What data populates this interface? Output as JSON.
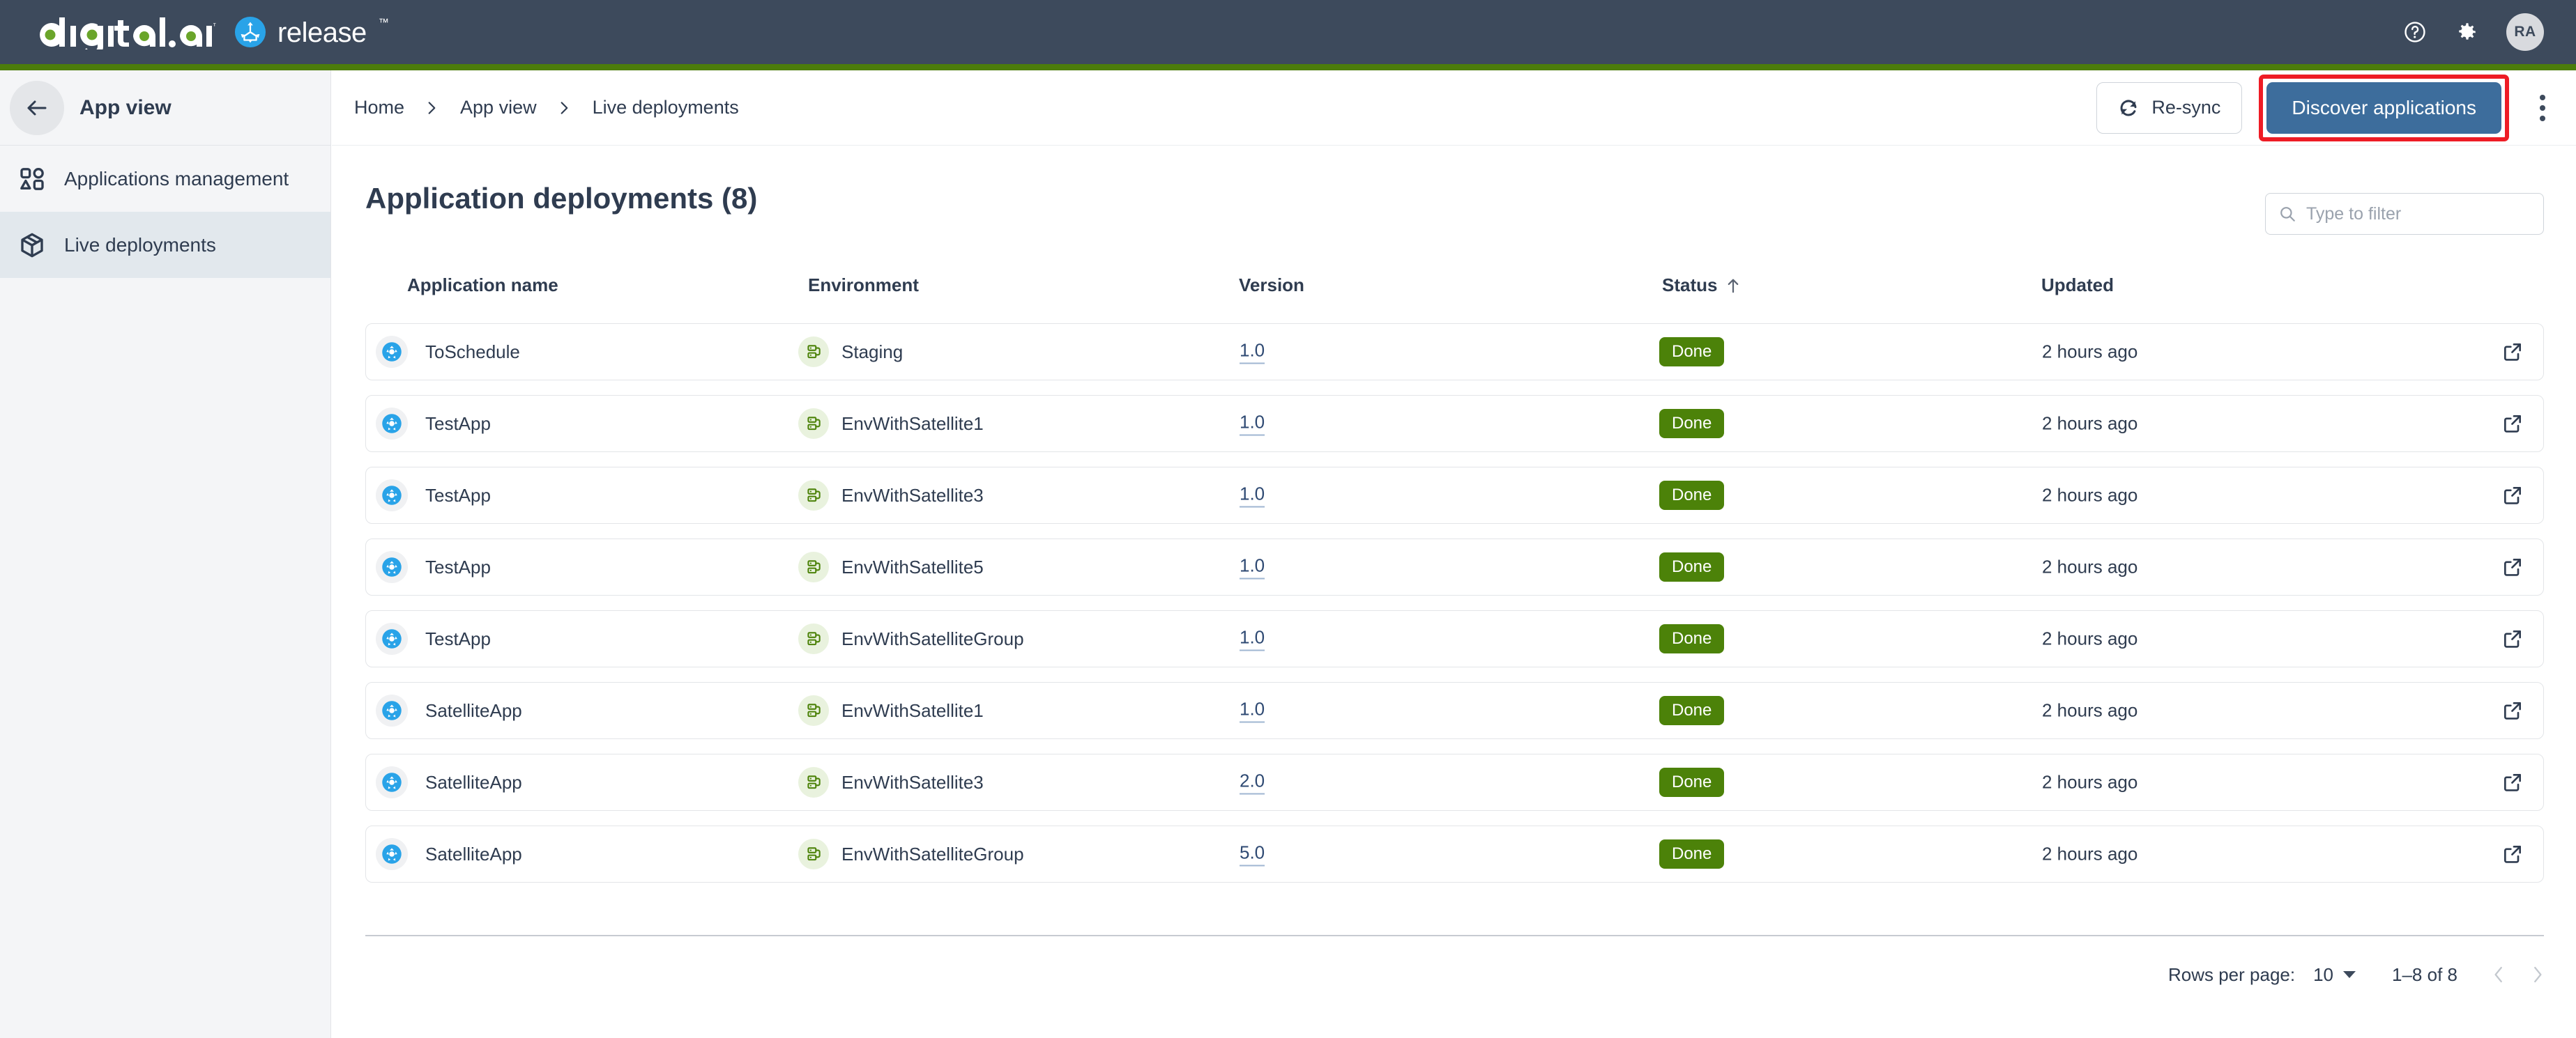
{
  "header": {
    "brand_primary": "digital.ai",
    "brand_secondary": "release",
    "trademark": "™",
    "help_icon": "help-circle-icon",
    "settings_icon": "gear-icon",
    "avatar_initials": "RA",
    "accent_green": "#4c7c0b",
    "bar_color": "#3d4a5c"
  },
  "sidebar": {
    "back_label": "App view",
    "back_icon": "arrow-left-icon",
    "items": [
      {
        "label": "Applications management",
        "icon": "shapes-icon",
        "active": false
      },
      {
        "label": "Live deployments",
        "icon": "package-icon",
        "active": true
      }
    ]
  },
  "breadcrumb": {
    "items": [
      "Home",
      "App view",
      "Live deployments"
    ],
    "separator_icon": "chevron-right-icon"
  },
  "toolbar": {
    "resync_label": "Re-sync",
    "resync_icon": "refresh-icon",
    "discover_label": "Discover applications",
    "discover_color": "#3d6d9c",
    "highlight_color": "#ee1c25",
    "overflow_icon": "more-vertical-icon"
  },
  "main": {
    "title": "Application deployments (8)",
    "deployment_count": 8,
    "filter": {
      "placeholder": "Type to filter",
      "value": "",
      "icon": "search-icon"
    },
    "columns": [
      {
        "key": "application_name",
        "label": "Application name",
        "sorted": false
      },
      {
        "key": "environment",
        "label": "Environment",
        "sorted": false
      },
      {
        "key": "version",
        "label": "Version",
        "sorted": false
      },
      {
        "key": "status",
        "label": "Status",
        "sorted": true,
        "sort_direction": "asc",
        "sort_icon": "arrow-up-icon"
      },
      {
        "key": "updated",
        "label": "Updated",
        "sorted": false
      }
    ],
    "rows": [
      {
        "application_name": "ToSchedule",
        "environment": "Staging",
        "version": "1.0",
        "status": "Done",
        "updated": "2 hours ago"
      },
      {
        "application_name": "TestApp",
        "environment": "EnvWithSatellite1",
        "version": "1.0",
        "status": "Done",
        "updated": "2 hours ago"
      },
      {
        "application_name": "TestApp",
        "environment": "EnvWithSatellite3",
        "version": "1.0",
        "status": "Done",
        "updated": "2 hours ago"
      },
      {
        "application_name": "TestApp",
        "environment": "EnvWithSatellite5",
        "version": "1.0",
        "status": "Done",
        "updated": "2 hours ago"
      },
      {
        "application_name": "TestApp",
        "environment": "EnvWithSatelliteGroup",
        "version": "1.0",
        "status": "Done",
        "updated": "2 hours ago"
      },
      {
        "application_name": "SatelliteApp",
        "environment": "EnvWithSatellite1",
        "version": "1.0",
        "status": "Done",
        "updated": "2 hours ago"
      },
      {
        "application_name": "SatelliteApp",
        "environment": "EnvWithSatellite3",
        "version": "2.0",
        "status": "Done",
        "updated": "2 hours ago"
      },
      {
        "application_name": "SatelliteApp",
        "environment": "EnvWithSatelliteGroup",
        "version": "5.0",
        "status": "Done",
        "updated": "2 hours ago"
      }
    ],
    "row_icons": {
      "application": "deployment-app-icon",
      "environment": "environment-server-icon",
      "open_external": "external-link-icon"
    },
    "status_color": "#4c8209"
  },
  "pagination": {
    "rows_per_page_label": "Rows per page:",
    "rows_per_page_value": "10",
    "range_label": "1–8 of 8",
    "prev_icon": "chevron-left-icon",
    "next_icon": "chevron-right-icon",
    "prev_disabled": true,
    "next_disabled": true
  }
}
